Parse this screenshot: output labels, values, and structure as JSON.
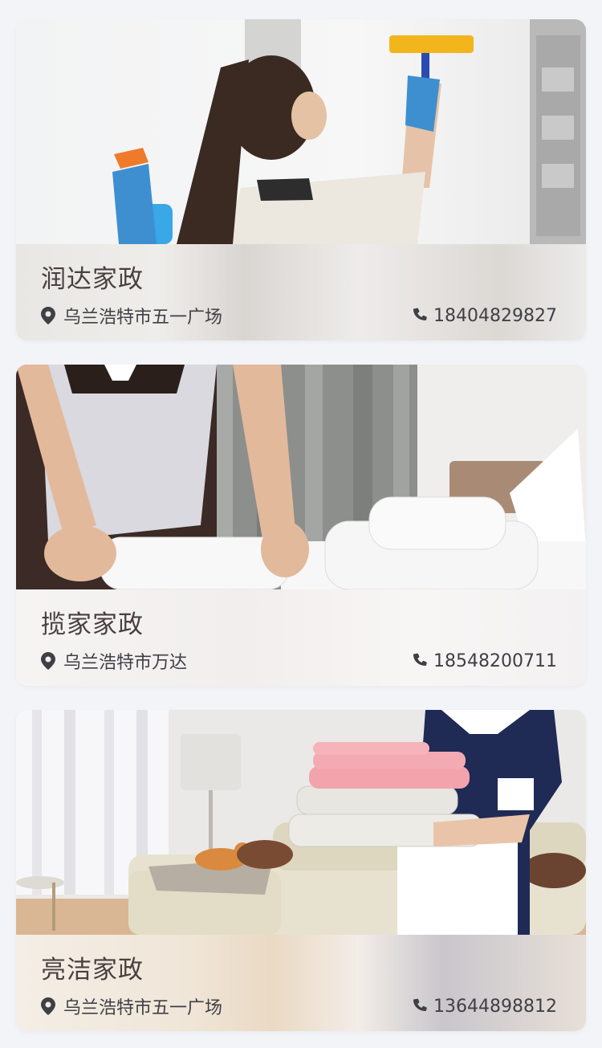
{
  "listings": [
    {
      "name": "润达家政",
      "address": "乌兰浩特市五一广场",
      "phone": "18404829827",
      "image": "woman-cleaning-window"
    },
    {
      "name": "揽家家政",
      "address": "乌兰浩特市万达",
      "phone": "18548200711",
      "image": "maid-folding-towels"
    },
    {
      "name": "亮洁家政",
      "address": "乌兰浩特市五一广场",
      "phone": "13644898812",
      "image": "housekeeper-holding-towels"
    }
  ],
  "icons": {
    "location": "location-pin-icon",
    "phone": "phone-icon"
  },
  "colors": {
    "page_background": "#f3f4f8",
    "title_text": "#4a3f3f",
    "body_text": "#3f3f46"
  }
}
